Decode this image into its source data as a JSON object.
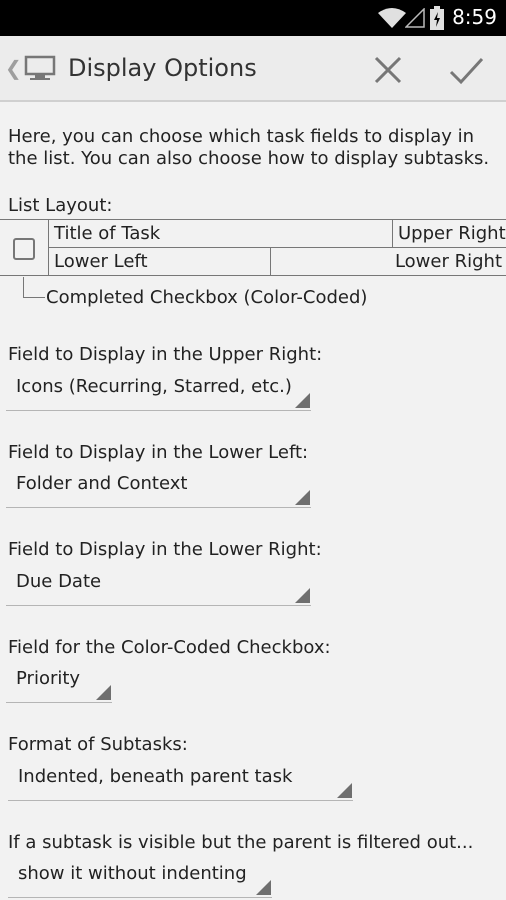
{
  "status_bar": {
    "time": "8:59"
  },
  "action_bar": {
    "title": "Display Options"
  },
  "intro": "Here, you can choose which task fields to display in the list. You can also choose how to display subtasks.",
  "list_layout": {
    "label": "List Layout:",
    "title_of_task": "Title of Task",
    "upper_right": "Upper Right",
    "lower_left": "Lower Left",
    "lower_right": "Lower Right",
    "completed_checkbox": "Completed Checkbox (Color-Coded)"
  },
  "fields": [
    {
      "label": "Field to Display in the Upper Right:",
      "value": "Icons (Recurring, Starred, etc.)"
    },
    {
      "label": "Field to Display in the Lower Left:",
      "value": "Folder and Context"
    },
    {
      "label": "Field to Display in the Lower Right:",
      "value": "Due Date"
    },
    {
      "label": "Field for the Color-Coded Checkbox:",
      "value": "Priority"
    },
    {
      "label": "Format of Subtasks:",
      "value": "Indented, beneath parent task"
    },
    {
      "label": "If a subtask is visible but the parent is filtered out...",
      "value": "show it without indenting"
    }
  ]
}
